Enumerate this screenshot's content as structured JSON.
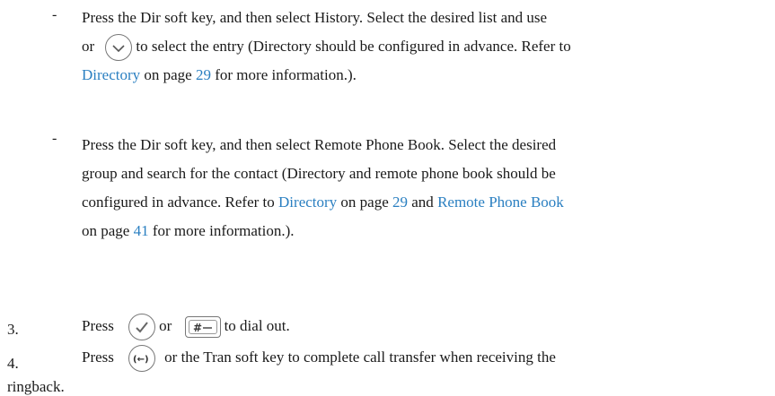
{
  "items": {
    "history": {
      "t1": "Press the Dir soft key, and then select History. Select the desired list and use",
      "t2": "or",
      "t3": "to select the entry (Directory should be configured in advance. Refer to",
      "link_directory": "Directory",
      "t4": " on page ",
      "page_29": "29",
      "t5": " for more information.)."
    },
    "remote": {
      "t1": "Press the Dir soft key, and then select Remote Phone Book. Select the desired",
      "t2": "group and search for the contact (Directory and remote phone book should be",
      "t3": "configured in advance. Refer to ",
      "link_directory": "Directory",
      "t4": " on page ",
      "page_29": "29",
      "t5": " and ",
      "link_remote": "Remote Phone Book",
      "t6": "on page ",
      "page_41": "41",
      "t7": " for more information.)."
    }
  },
  "steps": {
    "s3": {
      "number": "3.",
      "press": "Press",
      "or": "or",
      "tail": "to dial out."
    },
    "s4": {
      "number": "4.",
      "press": "Press",
      "tail": "or the Tran soft key to complete call transfer when receiving the",
      "tail2": "ringback."
    }
  },
  "dash": "-",
  "icons": [
    "down-navigation-key-icon",
    "ok-key-icon",
    "pound-send-key-icon",
    "transfer-key-icon"
  ],
  "colors": {
    "link": "#2a7fc1",
    "text": "#1a1a1a"
  }
}
